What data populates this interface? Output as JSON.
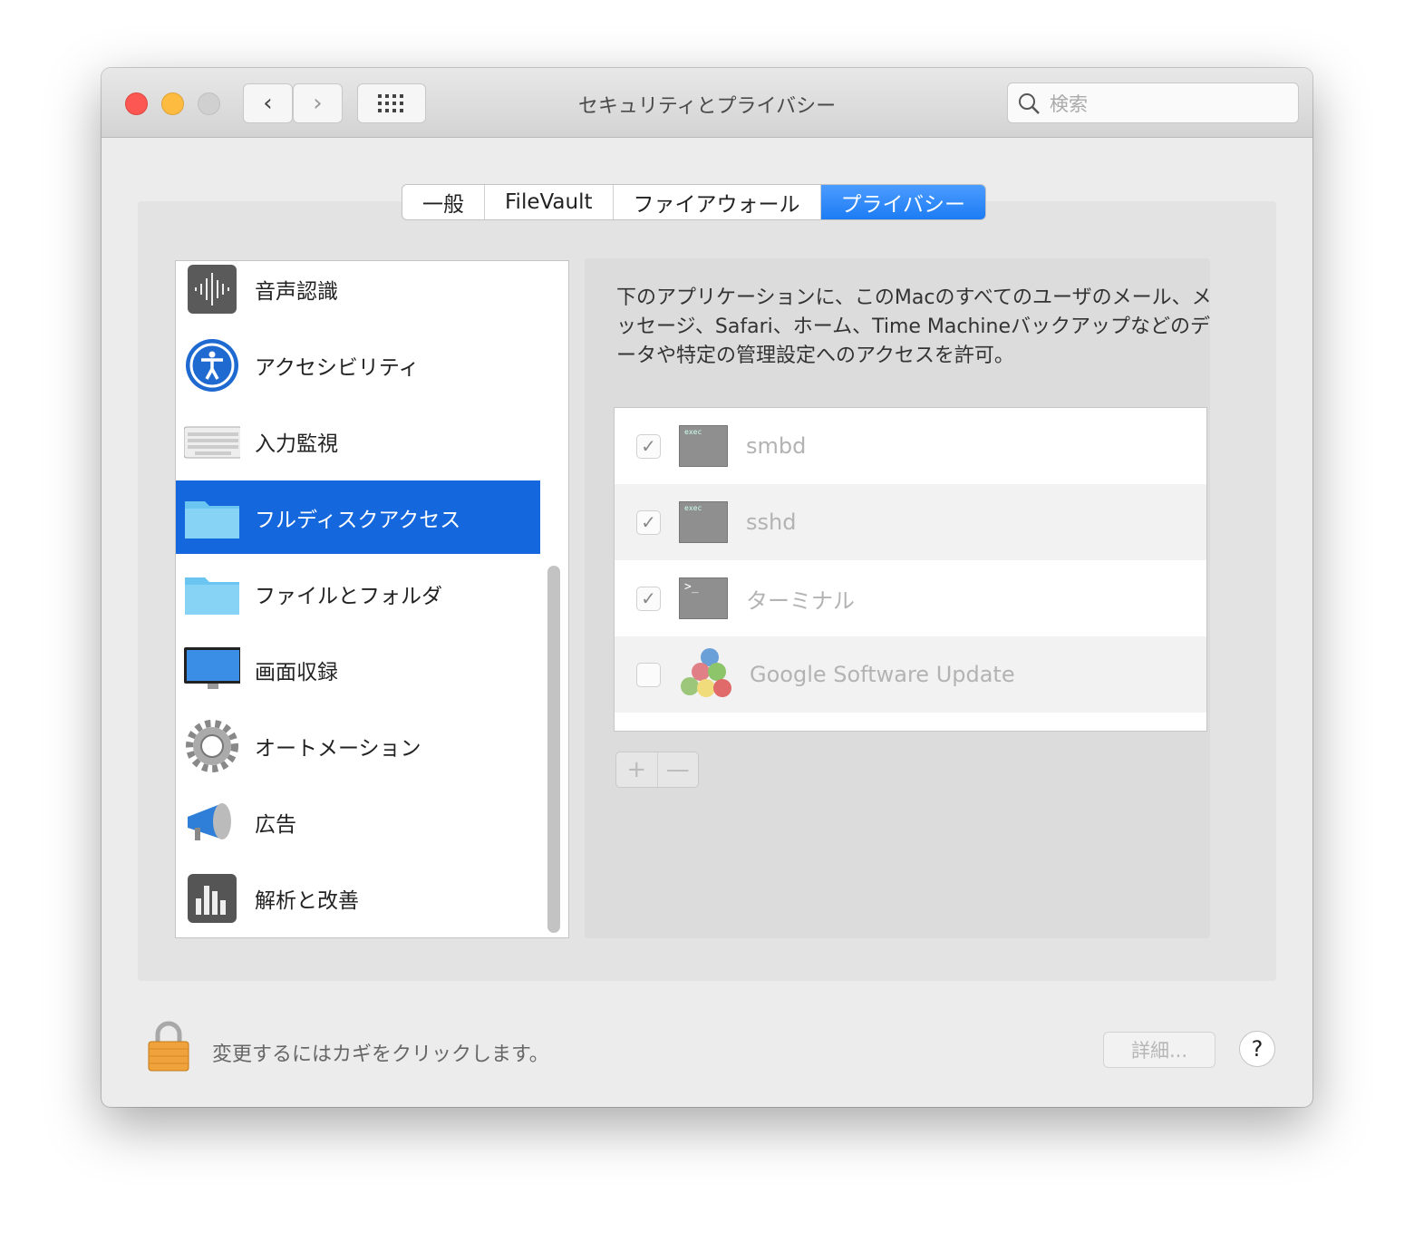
{
  "window": {
    "title": "セキュリティとプライバシー",
    "search_placeholder": "検索"
  },
  "colors": {
    "close": "#fc5753",
    "minimize": "#fdbc40",
    "zoom_disabled": "#d0d0d0",
    "accent": "#1467dc"
  },
  "tabs": [
    {
      "label": "一般"
    },
    {
      "label": "FileVault"
    },
    {
      "label": "ファイアウォール"
    },
    {
      "label": "プライバシー",
      "active": true
    }
  ],
  "sidebar": {
    "items": [
      {
        "label": "音声認識",
        "icon": "speech-recognition-icon"
      },
      {
        "label": "アクセシビリティ",
        "icon": "accessibility-icon"
      },
      {
        "label": "入力監視",
        "icon": "keyboard-icon"
      },
      {
        "label": "フルディスクアクセス",
        "icon": "folder-icon",
        "selected": true
      },
      {
        "label": "ファイルとフォルダ",
        "icon": "folder-icon"
      },
      {
        "label": "画面収録",
        "icon": "display-icon"
      },
      {
        "label": "オートメーション",
        "icon": "gear-icon"
      },
      {
        "label": "広告",
        "icon": "megaphone-icon"
      },
      {
        "label": "解析と改善",
        "icon": "analytics-chart-icon"
      }
    ]
  },
  "main": {
    "description": "下のアプリケーションに、このMacのすべてのユーザのメール、メッセージ、Safari、ホーム、Time Machineバックアップなどのデータや特定の管理設定へのアクセスを許可。",
    "apps": [
      {
        "name": "smbd",
        "checked": true,
        "icon": "exec-icon",
        "icon_text": "exec"
      },
      {
        "name": "sshd",
        "checked": true,
        "icon": "exec-icon",
        "icon_text": "exec"
      },
      {
        "name": "ターミナル",
        "checked": true,
        "icon": "terminal-icon",
        "icon_text": ">_"
      },
      {
        "name": "Google Software Update",
        "checked": false,
        "icon": "google-software-update-icon"
      }
    ],
    "add_label": "+",
    "remove_label": "—"
  },
  "footer": {
    "lock_text": "変更するにはカギをクリックします。",
    "details_label": "詳細...",
    "help_label": "?"
  }
}
